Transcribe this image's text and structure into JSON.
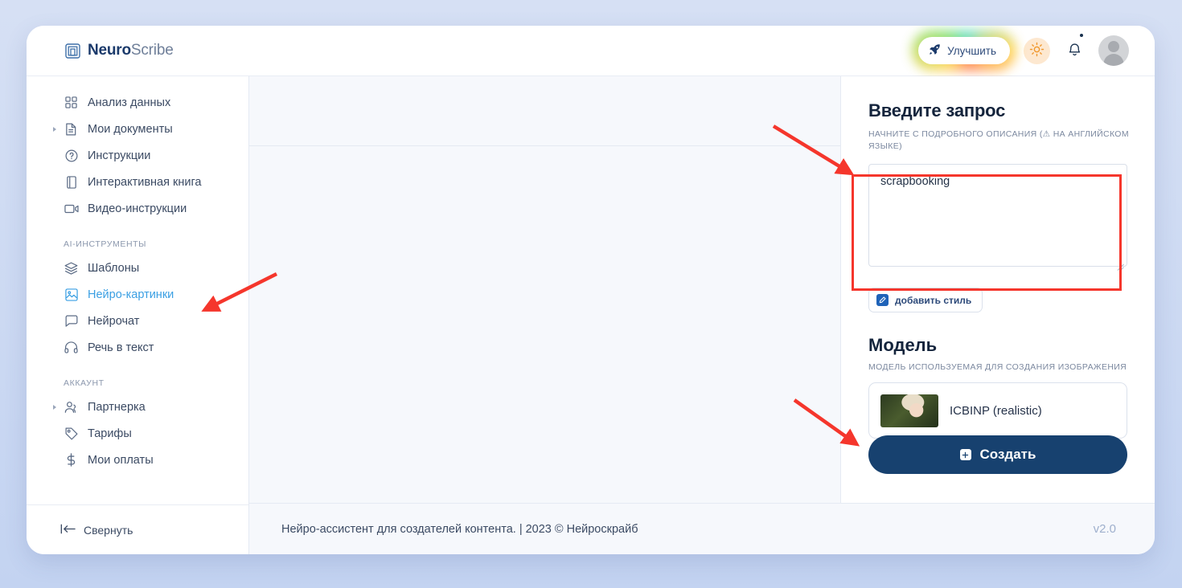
{
  "header": {
    "logo_bold": "Neuro",
    "logo_light": "Scribe",
    "upgrade_label": "Улучшить",
    "icons": {
      "rocket": "rocket-icon",
      "theme": "sun-icon",
      "bell": "bell-icon",
      "avatar": "avatar"
    }
  },
  "sidebar": {
    "items": [
      {
        "label": "Анализ данных",
        "icon": "grid-icon",
        "expandable": false,
        "active": false
      },
      {
        "label": "Мои документы",
        "icon": "document-icon",
        "expandable": true,
        "active": false
      },
      {
        "label": "Инструкции",
        "icon": "question-circle-icon",
        "expandable": false,
        "active": false
      },
      {
        "label": "Интерактивная книга",
        "icon": "book-icon",
        "expandable": false,
        "active": false
      },
      {
        "label": "Видео-инструкции",
        "icon": "video-camera-icon",
        "expandable": false,
        "active": false
      }
    ],
    "section_ai": "AI-ИНСТРУМЕНТЫ",
    "ai_items": [
      {
        "label": "Шаблоны",
        "icon": "layers-icon",
        "expandable": false,
        "active": false
      },
      {
        "label": "Нейро-картинки",
        "icon": "image-icon",
        "expandable": false,
        "active": true
      },
      {
        "label": "Нейрочат",
        "icon": "chat-bubble-icon",
        "expandable": false,
        "active": false
      },
      {
        "label": "Речь в текст",
        "icon": "headphones-icon",
        "expandable": false,
        "active": false
      }
    ],
    "section_account": "АККАУНТ",
    "account_items": [
      {
        "label": "Партнерка",
        "icon": "users-icon",
        "expandable": true,
        "active": false
      },
      {
        "label": "Тарифы",
        "icon": "tag-icon",
        "expandable": false,
        "active": false
      },
      {
        "label": "Мои оплаты",
        "icon": "dollar-icon",
        "expandable": false,
        "active": false
      }
    ],
    "collapse_label": "Свернуть",
    "collapse_icon": "collapse-left-icon"
  },
  "panel": {
    "prompt_title": "Введите запрос",
    "prompt_subtitle": "НАЧНИТЕ С ПОДРОБНОГО ОПИСАНИЯ (⚠ НА АНГЛИЙСКОМ ЯЗЫКЕ)",
    "prompt_value": "scrapbooking",
    "prompt_placeholder": "",
    "style_button": "добавить стиль",
    "style_icon": "edit-pencil-icon",
    "model_title": "Модель",
    "model_subtitle": "МОДЕЛЬ ИСПОЛЬЗУЕМАЯ ДЛЯ СОЗДАНИЯ ИЗОБРАЖЕНИЯ",
    "model_selected": "ICBINP (realistic)",
    "create_label": "Создать",
    "create_icon": "image-plus-icon"
  },
  "footer": {
    "text": "Нейро-ассистент для создателей контента.  | 2023 © Нейроскрайб",
    "version": "v2.0"
  },
  "colors": {
    "accent_navy": "#17416f",
    "accent_blue": "#3a9fe3",
    "annotation_red": "#f5362c",
    "page_bg": "#c3d3f1",
    "canvas_bg": "#f6f8fc"
  }
}
